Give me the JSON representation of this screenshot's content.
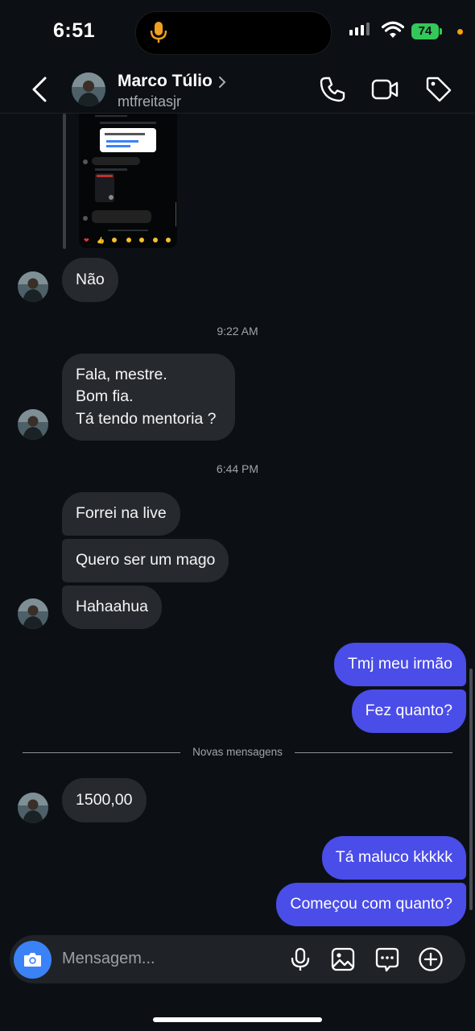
{
  "status_bar": {
    "time": "6:51",
    "battery": "74"
  },
  "header": {
    "name": "Marco Túlio",
    "username": "mtfreitasjr"
  },
  "thread": {
    "messages": [
      {
        "from": "them",
        "lines": [
          "Não"
        ]
      },
      {
        "type": "timestamp",
        "text": "9:22 AM"
      },
      {
        "from": "them",
        "lines": [
          "Fala, mestre.",
          "Bom fia.",
          "Tá tendo mentoria ?"
        ]
      },
      {
        "type": "timestamp",
        "text": "6:44 PM"
      },
      {
        "from": "them",
        "lines": [
          "Forrei na live"
        ]
      },
      {
        "from": "them",
        "lines": [
          "Quero ser um mago"
        ]
      },
      {
        "from": "them",
        "lines": [
          "Hahaahua"
        ]
      },
      {
        "from": "me",
        "lines": [
          "Tmj meu irmão"
        ]
      },
      {
        "from": "me",
        "lines": [
          "Fez quanto?"
        ]
      },
      {
        "type": "divider",
        "text": "Novas mensagens"
      },
      {
        "from": "them",
        "lines": [
          "1500,00"
        ]
      },
      {
        "from": "me",
        "lines": [
          "Tá maluco kkkkk"
        ]
      },
      {
        "from": "me",
        "lines": [
          "Começou com quanto?"
        ]
      }
    ]
  },
  "composer": {
    "placeholder": "Mensagem..."
  },
  "colors": {
    "background": "#0c1014",
    "incoming": "#262a2f",
    "outgoing": "#4a4de8",
    "camera": "#3b82f6"
  }
}
